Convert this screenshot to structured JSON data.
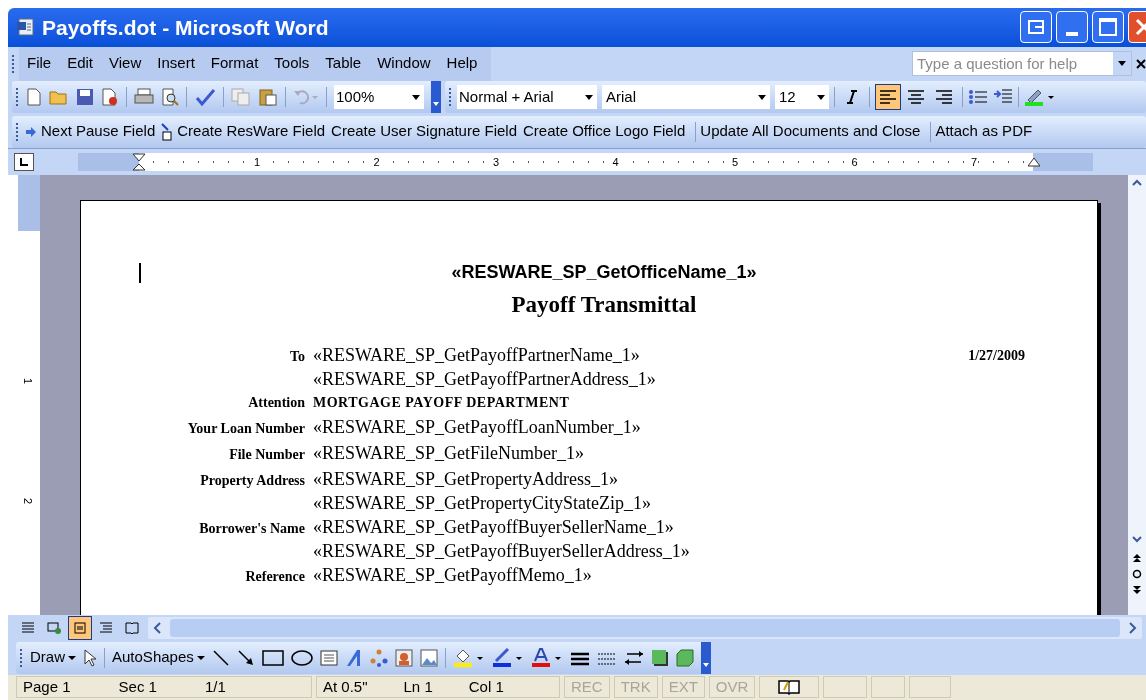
{
  "window": {
    "title": "Payoffs.dot - Microsoft Word"
  },
  "menu": [
    {
      "label": "File"
    },
    {
      "label": "Edit"
    },
    {
      "label": "View"
    },
    {
      "label": "Insert"
    },
    {
      "label": "Format"
    },
    {
      "label": "Tools"
    },
    {
      "label": "Table"
    },
    {
      "label": "Window"
    },
    {
      "label": "Help"
    }
  ],
  "help": {
    "placeholder": "Type a question for help"
  },
  "standard_toolbar": {
    "zoom": "100%"
  },
  "formatting_toolbar": {
    "style": "Normal + Arial",
    "font": "Arial",
    "size": "12",
    "italic": false,
    "alignment": [
      {
        "kind": "left",
        "selected": true
      },
      {
        "kind": "center",
        "selected": false
      },
      {
        "kind": "right",
        "selected": false
      }
    ]
  },
  "custom_toolbar": [
    {
      "buttons": [
        {
          "kind": "arrow",
          "label": "Next Pause Field"
        },
        {
          "kind": "field",
          "label": "Create ResWare Field"
        },
        {
          "kind": "none",
          "label": "Create User Signature Field"
        },
        {
          "kind": "none",
          "label": "Create Office Logo Field"
        }
      ]
    },
    {
      "buttons": [
        {
          "kind": "none",
          "label": "Update All Documents and Close"
        }
      ]
    },
    {
      "buttons": [
        {
          "kind": "none",
          "label": "Attach as PDF"
        }
      ]
    }
  ],
  "ruler": {
    "marks": [
      "1",
      "2",
      "3",
      "4",
      "5",
      "6",
      "7"
    ],
    "vertical_marks": [
      "1",
      "2"
    ]
  },
  "document": {
    "office": "«RESWARE_SP_GetOfficeName_1»",
    "title": "Payoff Transmittal",
    "date": "1/27/2009",
    "rows": [
      {
        "label": "To",
        "values": [
          "«RESWARE_SP_GetPayoffPartnerName_1»",
          "«RESWARE_SP_GetPayoffPartnerAddress_1»"
        ],
        "kind": "field"
      },
      {
        "label": "Attention",
        "values": [
          "MORTGAGE PAYOFF DEPARTMENT"
        ],
        "kind": "bold"
      },
      {
        "label": "Your Loan Number",
        "values": [
          "«RESWARE_SP_GetPayoffLoanNumber_1»"
        ],
        "kind": "field"
      },
      {
        "label": "File Number",
        "values": [
          "«RESWARE_SP_GetFileNumber_1»"
        ],
        "kind": "field"
      },
      {
        "label": "Property Address",
        "values": [
          "«RESWARE_SP_GetPropertyAddress_1»",
          "«RESWARE_SP_GetPropertyCityStateZip_1»"
        ],
        "kind": "field"
      },
      {
        "label": "Borrower's Name",
        "values": [
          "«RESWARE_SP_GetPayoffBuyerSellerName_1»",
          "«RESWARE_SP_GetPayoffBuyerSellerAddress_1»"
        ],
        "kind": "field"
      },
      {
        "label": "Reference",
        "values": [
          "«RESWARE_SP_GetPayoffMemo_1»"
        ],
        "kind": "field"
      }
    ]
  },
  "views": [
    {
      "kind": "normal",
      "selected": false
    },
    {
      "kind": "web",
      "selected": false
    },
    {
      "kind": "print",
      "selected": true
    },
    {
      "kind": "outline",
      "selected": false
    },
    {
      "kind": "reading",
      "selected": false
    }
  ],
  "drawing_toolbar": {
    "draw": "Draw",
    "autoshapes": "AutoShapes"
  },
  "status_bar": [
    {
      "items": [
        {
          "text": "Page 1",
          "disabled": false
        },
        {
          "text": "Sec 1",
          "disabled": false
        },
        {
          "text": "1/1",
          "disabled": false
        }
      ]
    },
    {
      "items": [
        {
          "text": "At 0.5\"",
          "disabled": false
        },
        {
          "text": "Ln 1",
          "disabled": false
        },
        {
          "text": "Col 1",
          "disabled": false
        }
      ]
    },
    {
      "items": [
        {
          "text": "REC",
          "disabled": true
        }
      ]
    },
    {
      "items": [
        {
          "text": "TRK",
          "disabled": true
        }
      ]
    },
    {
      "items": [
        {
          "text": "EXT",
          "disabled": true
        }
      ]
    },
    {
      "items": [
        {
          "text": "OVR",
          "disabled": true
        }
      ]
    }
  ]
}
